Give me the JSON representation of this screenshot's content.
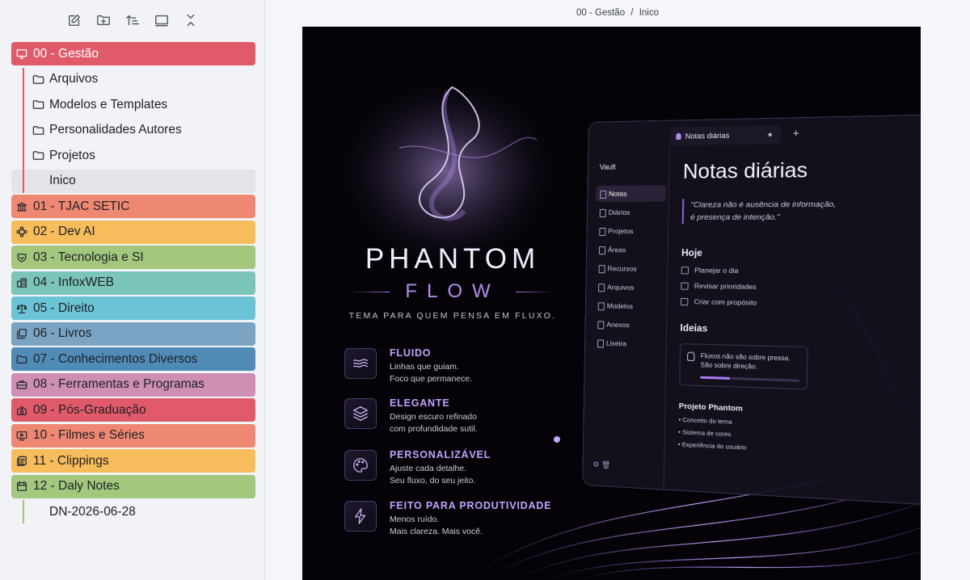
{
  "toolbar": {
    "icons": [
      "new-note-icon",
      "new-folder-icon",
      "sort-icon",
      "collapse-view-icon",
      "close-icon"
    ]
  },
  "sidebar": {
    "folders": [
      {
        "label": "00 - Gestão",
        "color": "#e05a6a",
        "icon": "desktop-icon",
        "open": true,
        "children": [
          "Arquivos",
          "Modelos e Templates",
          "Personalidades Autores",
          "Projetos"
        ],
        "file": "Inico"
      },
      {
        "label": "01 - TJAC SETIC",
        "color": "#ef8873",
        "icon": "bank-icon"
      },
      {
        "label": "02 -  Dev AI",
        "color": "#f7bc5b",
        "icon": "nodes-icon"
      },
      {
        "label": "03 - Tecnologia e SI",
        "color": "#a4c77e",
        "icon": "shield-icon"
      },
      {
        "label": "04 - InfoxWEB",
        "color": "#7bc4b8",
        "icon": "buildings-icon"
      },
      {
        "label": "05 - Direito",
        "color": "#6ac4d6",
        "icon": "scales-icon"
      },
      {
        "label": "06 - Livros",
        "color": "#7aa3c4",
        "icon": "books-icon"
      },
      {
        "label": "07 - Conhecimentos Diversos",
        "color": "#4f8bb5",
        "icon": "folder-icon"
      },
      {
        "label": "08 - Ferramentas e Programas",
        "color": "#cf8fb4",
        "icon": "toolbox-icon"
      },
      {
        "label": "09 -  Pós-Graduação",
        "color": "#e05a6a",
        "icon": "school-icon"
      },
      {
        "label": "10 -  Filmes e Séries",
        "color": "#ef8873",
        "icon": "tv-icon"
      },
      {
        "label": "11 - Clippings",
        "color": "#f7bc5b",
        "icon": "clipping-icon"
      },
      {
        "label": "12 - Daly Notes",
        "color": "#a4c77e",
        "icon": "calendar-icon",
        "open": true,
        "file": "DN-2026-06-28"
      }
    ]
  },
  "breadcrumb": {
    "parent": "00 - Gestão",
    "separator": "/",
    "current": "Inico"
  },
  "hero": {
    "brand_title": "PHANTOM",
    "brand_subtitle": "FLOW",
    "tagline": "TEMA PARA QUEM PENSA EM FLUXO.",
    "features": [
      {
        "icon": "waves-icon",
        "title": "FLUIDO",
        "line1": "Linhas que guiam.",
        "line2": "Foco que permanece."
      },
      {
        "icon": "layers-icon",
        "title": "ELEGANTE",
        "line1": "Design escuro refinado",
        "line2": "com profundidade sutil."
      },
      {
        "icon": "palette-icon",
        "title": "PERSONALIZÁVEL",
        "line1": "Ajuste cada detalhe.",
        "line2": "Seu fluxo, do seu jeito."
      },
      {
        "icon": "lightning-icon",
        "title": "FEITO PARA PRODUTIVIDADE",
        "line1": "Menos ruído.",
        "line2": "Mais clareza. Mais você."
      }
    ],
    "mock": {
      "tab": "Notas diárias",
      "vault": "Vault",
      "nav": [
        "Notas",
        "Diários",
        "Projetos",
        "Áreas",
        "Recursos",
        "Arquivos",
        "Modelos",
        "Anexos",
        "Lixeira"
      ],
      "heading": "Notas diárias",
      "quote_line1": "\"Clareza não é ausência de informação,",
      "quote_line2": "é presença de intenção.\"",
      "today_title": "Hoje",
      "todos": [
        "Planejar o dia",
        "Revisar prioridades",
        "Criar com propósito"
      ],
      "ideas_title": "Ideias",
      "idea_line1": "Fluxos não são sobre pressa.",
      "idea_line2": "São sobre direção.",
      "project_title": "Projeto Phantom",
      "project_items": [
        "Conceito do tema",
        "Sistema de cores",
        "Experiência do usuário"
      ]
    }
  }
}
